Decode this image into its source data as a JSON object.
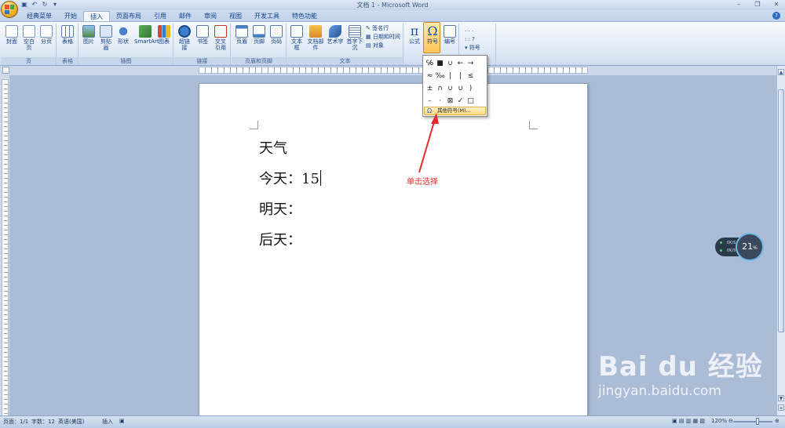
{
  "window": {
    "title": "文档 1 - Microsoft Word",
    "qat": [
      "save-icon",
      "undo-icon",
      "redo-icon",
      "dropdown"
    ]
  },
  "tabs": [
    "经典菜单",
    "开始",
    "插入",
    "页面布局",
    "引用",
    "邮件",
    "审阅",
    "视图",
    "开发工具",
    "特色功能"
  ],
  "ribbon": {
    "groups": {
      "pages": {
        "label": "页",
        "buttons": [
          "封面",
          "空白页",
          "分页"
        ]
      },
      "tables": {
        "label": "表格",
        "buttons": [
          "表格"
        ]
      },
      "illustrations": {
        "label": "插图",
        "buttons": [
          "图片",
          "剪贴画",
          "形状",
          "SmartArt",
          "图表"
        ]
      },
      "links": {
        "label": "链接",
        "buttons": [
          "超链接",
          "书签",
          "交叉引用"
        ]
      },
      "header_footer": {
        "label": "页眉和页脚",
        "buttons": [
          "页眉",
          "页脚",
          "页码"
        ]
      },
      "text": {
        "label": "文本",
        "buttons": [
          "文本框",
          "文档部件",
          "艺术字",
          "首字下沉"
        ],
        "small": [
          "签名行",
          "日期和时间",
          "对象"
        ]
      },
      "symbols": {
        "buttons": [
          "公式",
          "符号",
          "编号"
        ],
        "right_small": [
          "符号"
        ]
      }
    }
  },
  "symbol_dropdown": {
    "symbols": [
      "℅",
      "■",
      "∪",
      "←",
      "→",
      "≈",
      "‰",
      "|",
      "|",
      "≤",
      "±",
      "∩",
      "∪",
      "∪",
      ")",
      "–",
      "·",
      "⊠",
      "✓",
      "□"
    ],
    "more_label": "其他符号(M)..."
  },
  "document": {
    "lines": [
      "天气",
      "今天：15",
      "明天：",
      "后天："
    ]
  },
  "annotation": {
    "text": "单击选择",
    "color": "#e22b2b"
  },
  "widget": {
    "value": "21",
    "unit": "%",
    "rows": [
      "0K/S",
      "0K/S"
    ]
  },
  "watermark": {
    "brand": "Bai du 经验",
    "url": "jingyan.baidu.com"
  },
  "status": {
    "page": "页面：1/1",
    "words": "字数：12",
    "language": "英语(美国)",
    "mode": "插入",
    "zoom": "120%"
  },
  "colors": {
    "accent": "#2a6cc8",
    "active_button": "#ffc55a"
  }
}
